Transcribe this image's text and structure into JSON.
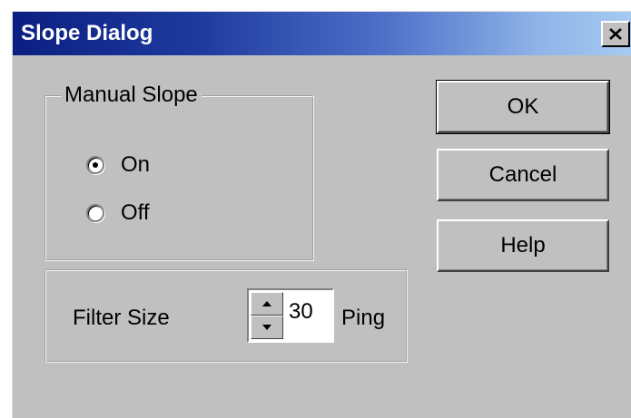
{
  "window": {
    "title": "Slope Dialog",
    "close_icon": "close-x-icon"
  },
  "manual_slope": {
    "legend": "Manual Slope",
    "options": [
      {
        "label": "On",
        "selected": true
      },
      {
        "label": "Off",
        "selected": false
      }
    ]
  },
  "filter": {
    "label": "Filter Size",
    "value": "30",
    "unit": "Ping",
    "up_icon": "spin-up-arrow-icon",
    "down_icon": "spin-down-arrow-icon"
  },
  "buttons": {
    "ok": "OK",
    "cancel": "Cancel",
    "help": "Help"
  },
  "colors": {
    "title_gradient_start": "#0b1f82",
    "title_gradient_end": "#a6caf0",
    "dialog_face": "#c0c0c0"
  }
}
